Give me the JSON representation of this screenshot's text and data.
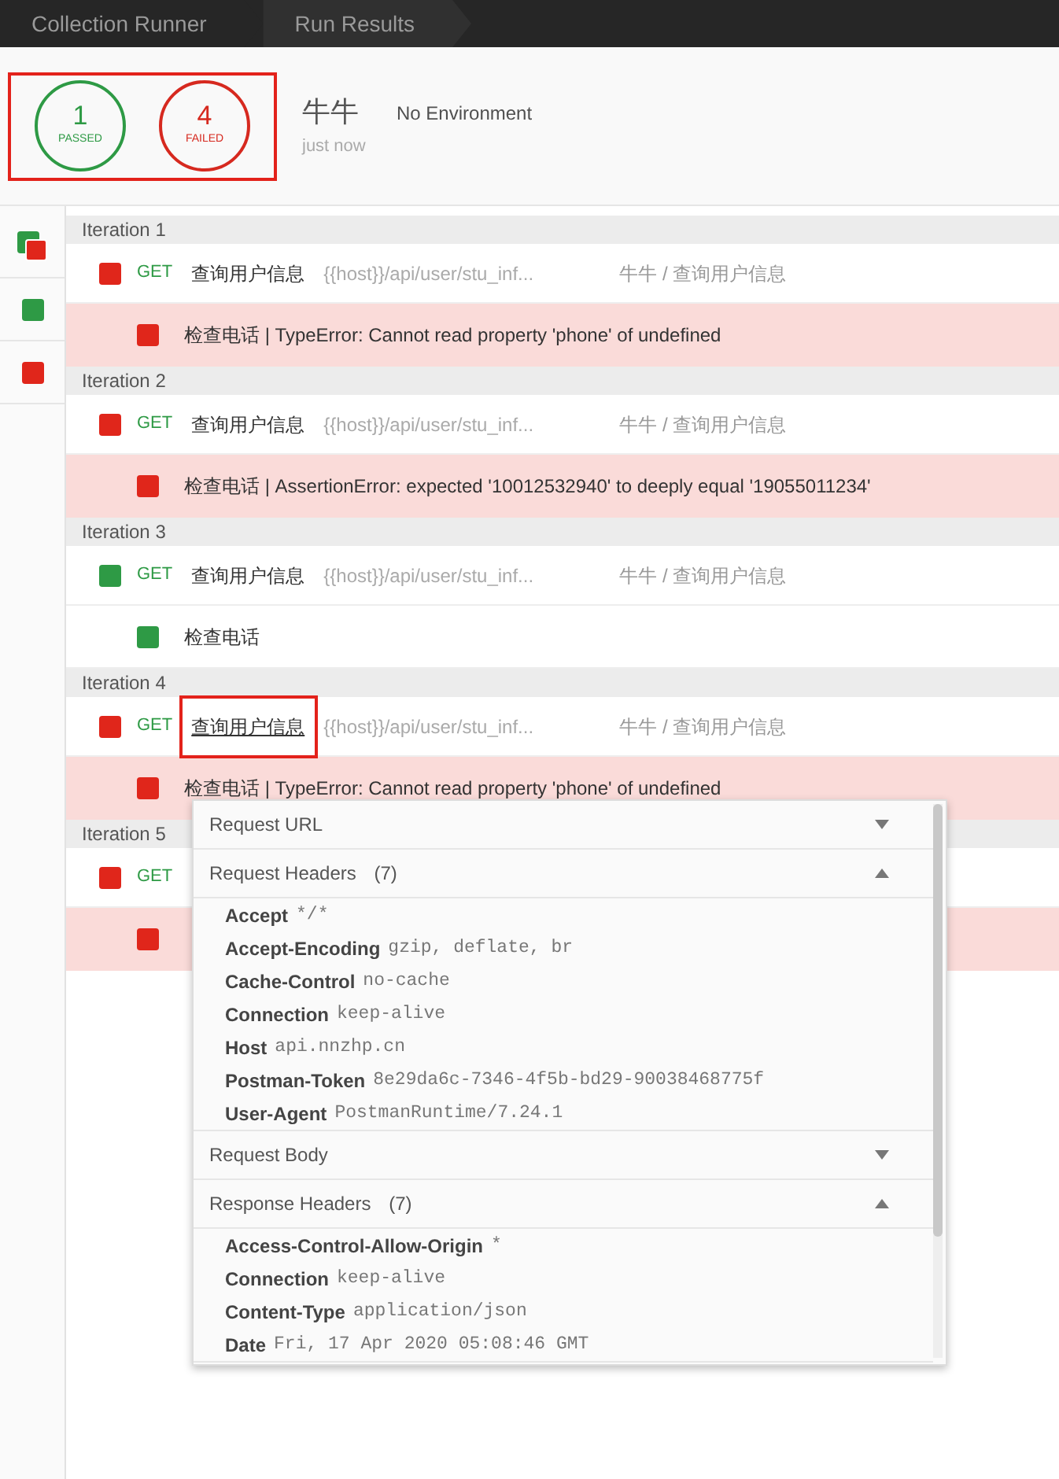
{
  "breadcrumb": [
    {
      "label": "Collection Runner"
    },
    {
      "label": "Run Results"
    }
  ],
  "summary": {
    "highlighted": true,
    "passed": {
      "count": "1",
      "label": "PASSED"
    },
    "failed": {
      "count": "4",
      "label": "FAILED"
    },
    "collection": "牛牛",
    "environment": "No Environment",
    "time": "just now"
  },
  "filters": [
    {
      "kind": "all"
    },
    {
      "kind": "passed"
    },
    {
      "kind": "failed"
    }
  ],
  "iterations": [
    {
      "title": "Iteration 1",
      "request": {
        "passed": false,
        "method": "GET",
        "name": "查询用户信息",
        "highlighted": false,
        "url": "{{host}}/api/user/stu_inf...",
        "path": "牛牛 / 查询用户信息"
      },
      "tests": [
        {
          "passed": false,
          "name": "检查电话",
          "message": "| TypeError: Cannot read property 'phone' of undefined"
        }
      ]
    },
    {
      "title": "Iteration 2",
      "request": {
        "passed": false,
        "method": "GET",
        "name": "查询用户信息",
        "highlighted": false,
        "url": "{{host}}/api/user/stu_inf...",
        "path": "牛牛 / 查询用户信息"
      },
      "tests": [
        {
          "passed": false,
          "name": "检查电话",
          "message": "| AssertionError: expected '10012532940' to deeply equal '19055011234'"
        }
      ]
    },
    {
      "title": "Iteration 3",
      "request": {
        "passed": true,
        "method": "GET",
        "name": "查询用户信息",
        "highlighted": false,
        "url": "{{host}}/api/user/stu_inf...",
        "path": "牛牛 / 查询用户信息"
      },
      "tests": [
        {
          "passed": true,
          "name": "检查电话"
        }
      ]
    },
    {
      "title": "Iteration 4",
      "request": {
        "passed": false,
        "method": "GET",
        "name": "查询用户信息",
        "highlighted": true,
        "url": "{{host}}/api/user/stu_inf...",
        "path": "牛牛 / 查询用户信息"
      },
      "tests": [
        {
          "passed": false,
          "name": "检查电话",
          "message": "| TypeError: Cannot read property 'phone' of undefined"
        }
      ]
    },
    {
      "title": "Iteration 5",
      "request": {
        "passed": false,
        "method": "GET"
      },
      "tests": [
        {
          "passed": false
        }
      ]
    }
  ],
  "popup": {
    "sections": [
      {
        "title": "Request URL",
        "expanded": false
      },
      {
        "title": "Request Headers",
        "count": "(7)",
        "expanded": true,
        "headers": [
          {
            "key": "Accept",
            "value": "*/*"
          },
          {
            "key": "Accept-Encoding",
            "value": "gzip, deflate, br"
          },
          {
            "key": "Cache-Control",
            "value": "no-cache"
          },
          {
            "key": "Connection",
            "value": "keep-alive"
          },
          {
            "key": "Host",
            "value": "api.nnzhp.cn"
          },
          {
            "key": "Postman-Token",
            "value": "8e29da6c-7346-4f5b-bd29-90038468775f"
          },
          {
            "key": "User-Agent",
            "value": "PostmanRuntime/7.24.1"
          }
        ]
      },
      {
        "title": "Request Body",
        "expanded": false
      },
      {
        "title": "Response Headers",
        "count": "(7)",
        "expanded": true,
        "headers": [
          {
            "key": "Access-Control-Allow-Origin",
            "value": "*"
          },
          {
            "key": "Connection",
            "value": "keep-alive"
          },
          {
            "key": "Content-Type",
            "value": "application/json"
          },
          {
            "key": "Date",
            "value": "Fri, 17 Apr 2020 05:08:46 GMT"
          }
        ]
      }
    ]
  }
}
